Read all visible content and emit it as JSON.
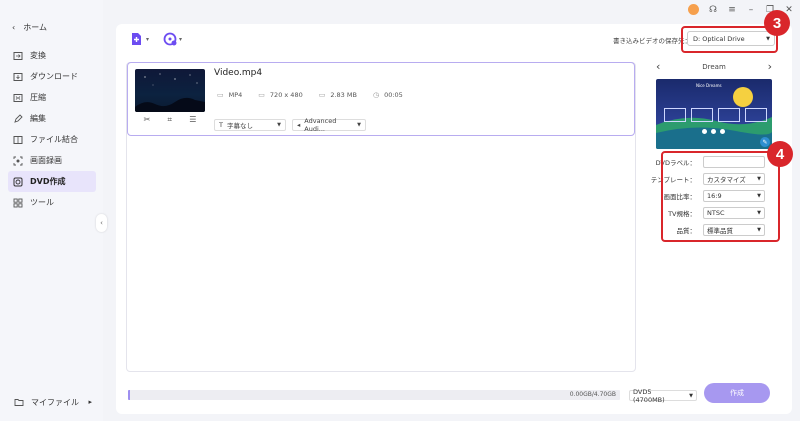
{
  "sidebar": {
    "home_label": "ホーム",
    "items": [
      {
        "label": "変換",
        "icon": "convert-icon"
      },
      {
        "label": "ダウンロード",
        "icon": "download-icon"
      },
      {
        "label": "圧縮",
        "icon": "compress-icon"
      },
      {
        "label": "編集",
        "icon": "edit-icon"
      },
      {
        "label": "ファイル結合",
        "icon": "merge-icon"
      },
      {
        "label": "画面録画",
        "icon": "screen-record-icon"
      },
      {
        "label": "DVD作成",
        "icon": "dvd-icon",
        "active": true
      },
      {
        "label": "ツール",
        "icon": "tools-icon"
      }
    ],
    "myfile_label": "マイファイル"
  },
  "toolbar": {
    "burn_target_label": "書き込みビデオの保存先：",
    "drive_value": "D: Optical Drive"
  },
  "video": {
    "name": "Video.mp4",
    "format": "MP4",
    "resolution": "720 x 480",
    "size": "2.83 MB",
    "duration": "00:05",
    "subtitle_value": "字幕なし",
    "audio_value": "Advanced Audi..."
  },
  "template": {
    "name": "Dream",
    "preview_title": "Nice Dreams"
  },
  "settings": {
    "dvd_label": {
      "label": "DVDラベル：",
      "value": ""
    },
    "template": {
      "label": "テンプレート：",
      "value": "カスタマイズ"
    },
    "aspect": {
      "label": "画面比率：",
      "value": "16:9"
    },
    "tv_standard": {
      "label": "TV規格：",
      "value": "NTSC"
    },
    "quality": {
      "label": "品質：",
      "value": "標準品質"
    }
  },
  "bottom": {
    "progress_text": "0.00GB/4.70GB",
    "progress_fraction": 0.0,
    "disc_value": "DVD5 (4700MB)",
    "burn_label": "作成"
  },
  "annotations": {
    "num3": "3",
    "num4": "4",
    "color": "#d9262b"
  },
  "colors": {
    "accent": "#6c4cf1",
    "active_bg": "#e8e4fb",
    "burn_button": "#a798f0"
  }
}
